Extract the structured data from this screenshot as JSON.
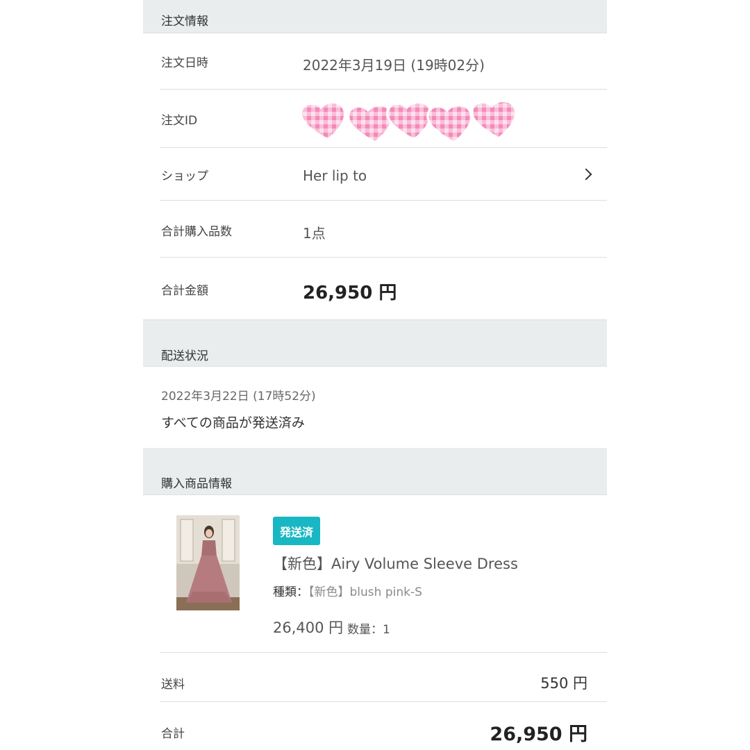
{
  "order_info": {
    "header": "注文情報",
    "rows": [
      {
        "label": "注文日時",
        "value": "2022年3月19日 (19時02分)"
      },
      {
        "label": "注文ID",
        "value": ""
      },
      {
        "label": "ショップ",
        "value": "Her lip to"
      },
      {
        "label": "合計購入品数",
        "value": "1点"
      },
      {
        "label": "合計金額",
        "value": "26,950 円"
      }
    ]
  },
  "shipping": {
    "header": "配送状況",
    "date": "2022年3月22日 (17時52分)",
    "status": "すべての商品が発送済み"
  },
  "product_info": {
    "header": "購入商品情報",
    "badge": "発送済",
    "name": "【新色】Airy Volume Sleeve Dress",
    "variant_label": "種類：",
    "variant_value": "【新色】blush pink-S",
    "price": "26,400 円",
    "quantity": "数量：1"
  },
  "totals": {
    "shipping_label": "送料",
    "shipping_value": "550 円",
    "total_label": "合計",
    "total_value": "26,950 円"
  },
  "colors": {
    "badge": "#19b7c4",
    "section_bg": "#e9edee",
    "heart_pink": "#f7a6c8"
  }
}
